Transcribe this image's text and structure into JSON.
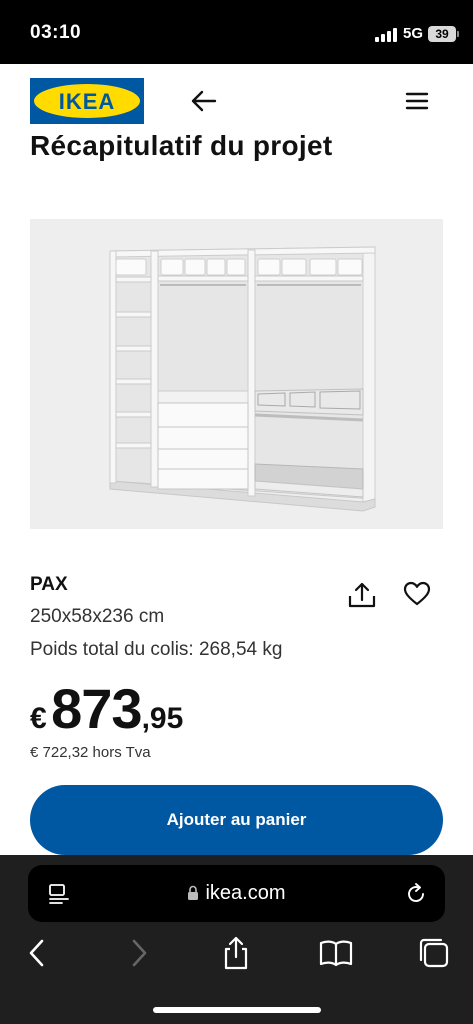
{
  "status_bar": {
    "time": "03:10",
    "network": "5G",
    "battery": "39",
    "icons": [
      "signal-icon",
      "battery-icon"
    ]
  },
  "header": {
    "logo_text": "IKEA",
    "icons": [
      "back-arrow-icon",
      "hamburger-menu-icon"
    ]
  },
  "page": {
    "title": "Récapitulatif du projet"
  },
  "product": {
    "image_alt_icon": "wardrobe-illustration",
    "name": "PAX",
    "dimensions": "250x58x236 cm",
    "weight": "Poids total du colis: 268,54 kg",
    "price": {
      "currency": "€",
      "integer": "873",
      "decimal": ",95"
    },
    "price_excl_vat": "€ 722,32 hors Tva",
    "icons": [
      "share-icon",
      "heart-icon"
    ]
  },
  "actions": {
    "add_to_cart": "Ajouter au panier"
  },
  "browser": {
    "url": "ikea.com",
    "icons": [
      "page-menu-icon",
      "lock-icon",
      "reload-icon",
      "back-icon",
      "forward-icon",
      "share-icon",
      "bookmarks-icon",
      "tabs-icon"
    ]
  },
  "colors": {
    "ikea_blue": "#0058a3",
    "ikea_yellow": "#ffdb00",
    "browser_bg": "#1f1f1f"
  }
}
